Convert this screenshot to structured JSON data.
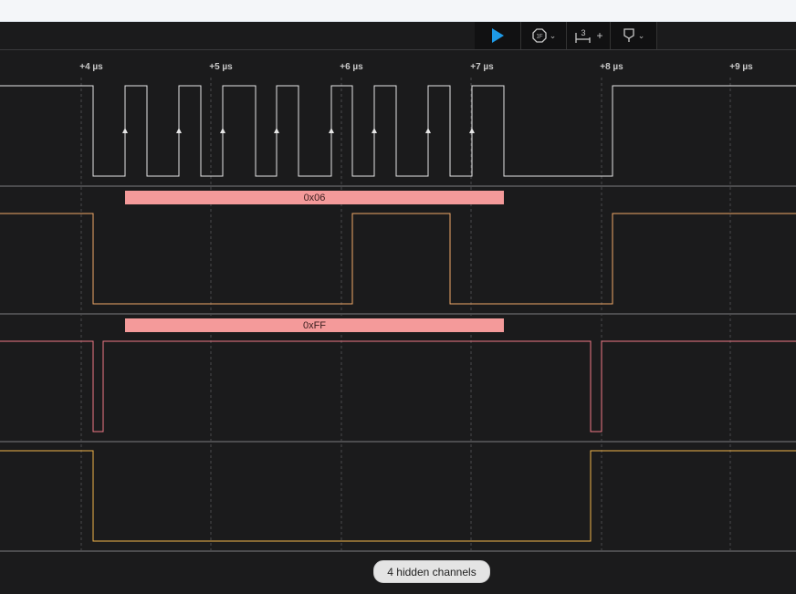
{
  "toolbar": {
    "play_icon": "play-icon",
    "trigger_icon": "trigger-icon",
    "trigger_label": "1F",
    "measure_icon": "measure-icon",
    "measure_count": "3",
    "measure_add": "+",
    "marker_icon": "marker-icon"
  },
  "ruler": {
    "ticks": [
      "+4 µs",
      "+5 µs",
      "+6 µs",
      "+7 µs",
      "+8 µs",
      "+9 µs"
    ]
  },
  "channels": [
    {
      "color": "#e6e6e6"
    },
    {
      "color": "#f0a868",
      "decode": "0x06"
    },
    {
      "color": "#f07a86",
      "decode": "0xFF"
    },
    {
      "color": "#f2b44a"
    }
  ],
  "colors": {
    "accent": "#1e9be8",
    "protocol_bar": "#f49a9a"
  },
  "footer": {
    "hidden_channels": "4 hidden channels"
  }
}
